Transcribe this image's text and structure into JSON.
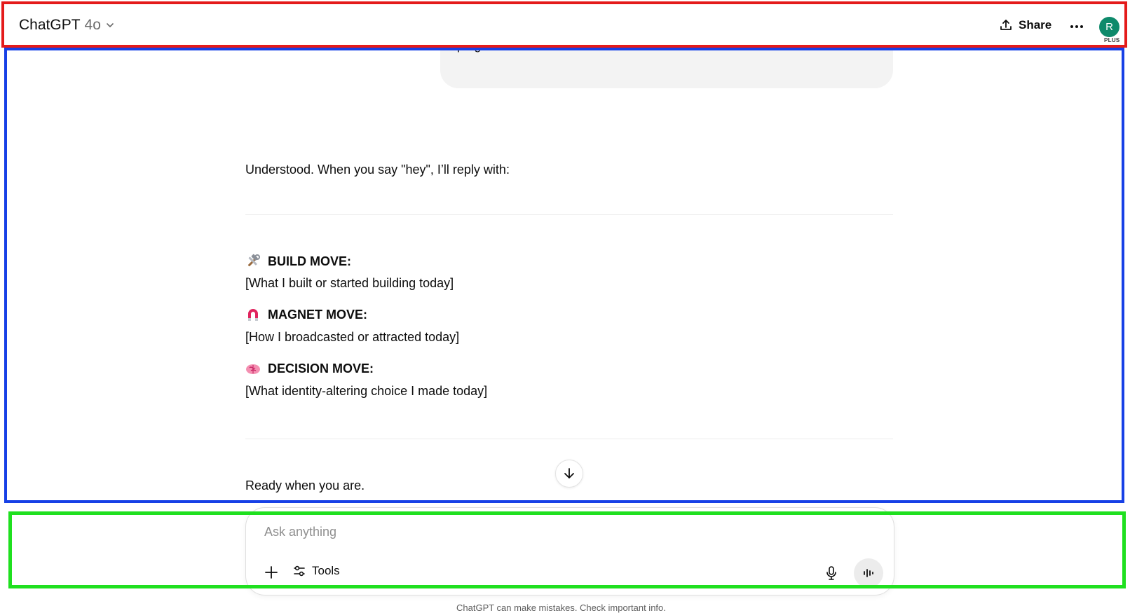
{
  "header": {
    "model_name": "ChatGPT",
    "model_version": "4o",
    "share_label": "Share",
    "avatar_initial": "R",
    "plan_badge": "PLUS"
  },
  "conversation": {
    "user_bubble_text": "progress",
    "reply_intro": "Understood. When you say \"hey\", I’ll reply with:",
    "moves": [
      {
        "icon": "hammer-wrench-icon",
        "title": "BUILD MOVE:",
        "description": "[What I built or started building today]"
      },
      {
        "icon": "magnet-icon",
        "title": "MAGNET MOVE:",
        "description": "[How I broadcasted or attracted today]"
      },
      {
        "icon": "brain-icon",
        "title": "DECISION MOVE:",
        "description": "[What identity-altering choice I made today]"
      }
    ],
    "closing": "Ready when you are."
  },
  "composer": {
    "placeholder": "Ask anything",
    "tools_label": "Tools"
  },
  "footer": {
    "note": "ChatGPT can make mistakes. Check important info."
  },
  "colors": {
    "annotation_red": "#e41b1b",
    "annotation_blue": "#1740e6",
    "annotation_green": "#1fe01f",
    "avatar_bg": "#0e8a6b",
    "bubble_bg": "#f3f3f3"
  }
}
